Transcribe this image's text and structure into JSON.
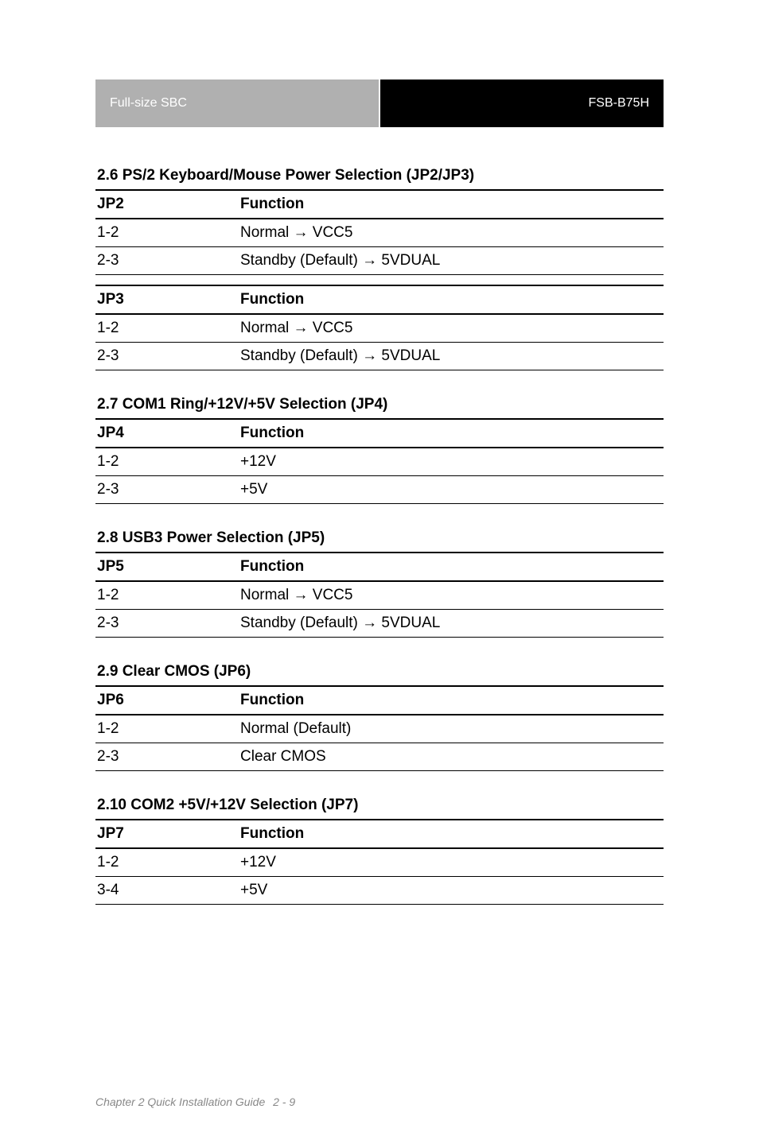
{
  "header": {
    "left": "Full-size SBC",
    "right": "FSB-B75H"
  },
  "sections": [
    {
      "title": "2.6 PS/2 Keyboard/Mouse Power Selection (JP2/JP3)",
      "subtables": [
        {
          "header": {
            "col1": "JP2",
            "col2": "Function"
          },
          "rows": [
            {
              "col1": "1-2",
              "col2": "Normal → VCC5"
            },
            {
              "col1": "2-3",
              "col2": "Standby (Default) → 5VDUAL"
            }
          ]
        },
        {
          "header": {
            "col1": "JP3",
            "col2": "Function"
          },
          "rows": [
            {
              "col1": "1-2",
              "col2": "Normal → VCC5"
            },
            {
              "col1": "2-3",
              "col2": "Standby (Default) → 5VDUAL"
            }
          ]
        }
      ]
    },
    {
      "title": "2.7 COM1 Ring/+12V/+5V Selection (JP4)",
      "subtables": [
        {
          "header": {
            "col1": "JP4",
            "col2": "Function"
          },
          "rows": [
            {
              "col1": "1-2",
              "col2": "+12V"
            },
            {
              "col1": "2-3",
              "col2": "+5V"
            }
          ]
        }
      ]
    },
    {
      "title": "2.8 USB3 Power Selection (JP5)",
      "subtables": [
        {
          "header": {
            "col1": "JP5",
            "col2": "Function"
          },
          "rows": [
            {
              "col1": "1-2",
              "col2": "Normal → VCC5"
            },
            {
              "col1": "2-3",
              "col2": "Standby (Default) → 5VDUAL"
            }
          ]
        }
      ]
    },
    {
      "title": "2.9 Clear CMOS (JP6)",
      "subtables": [
        {
          "header": {
            "col1": "JP6",
            "col2": "Function"
          },
          "rows": [
            {
              "col1": "1-2",
              "col2": "Normal (Default)"
            },
            {
              "col1": "2-3",
              "col2": "Clear CMOS"
            }
          ]
        }
      ]
    },
    {
      "title": "2.10 COM2 +5V/+12V Selection (JP7)",
      "subtables": [
        {
          "header": {
            "col1": "JP7",
            "col2": "Function"
          },
          "rows": [
            {
              "col1": "1-2",
              "col2": "+12V"
            },
            {
              "col1": "3-4",
              "col2": "+5V"
            }
          ]
        }
      ]
    }
  ],
  "footer": {
    "chapter": "Chapter 2 Quick Installation Guide",
    "page": "2 - 9"
  }
}
